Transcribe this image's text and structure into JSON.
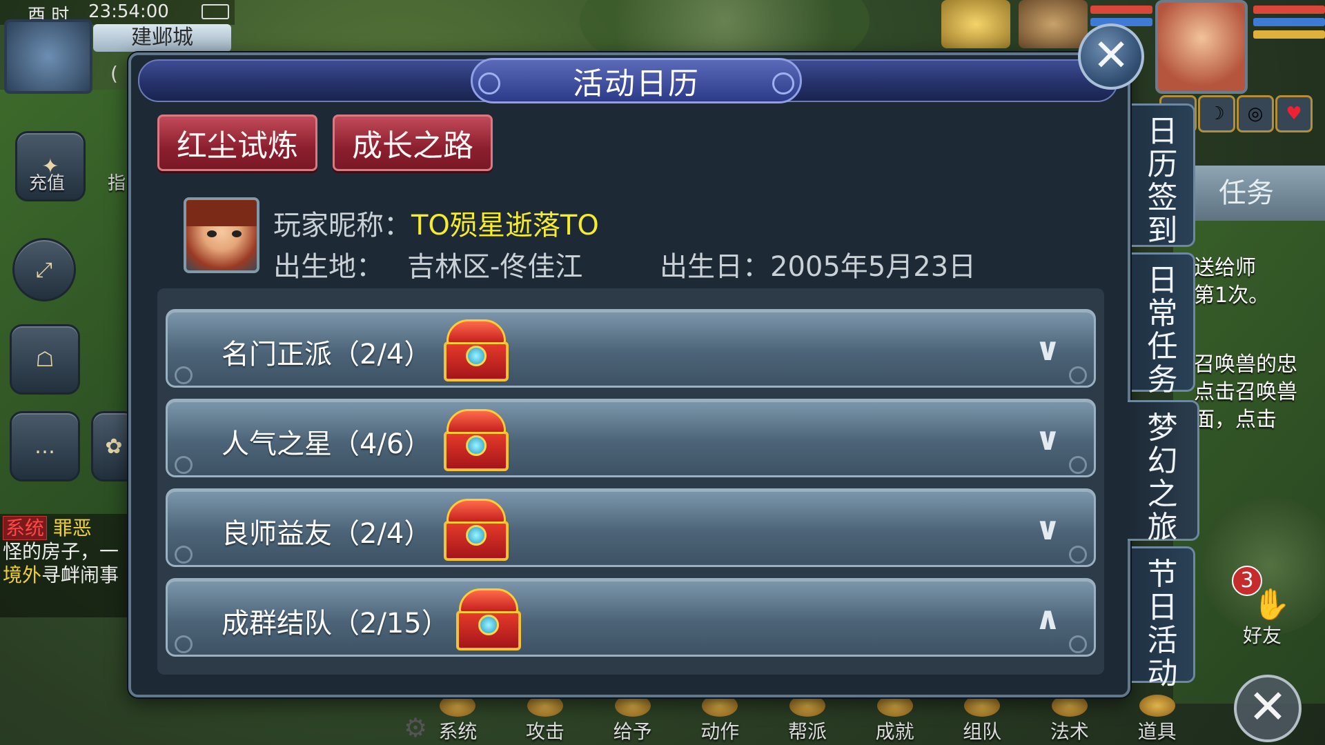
{
  "hud": {
    "clock_label": "酉 时",
    "time": "23:54:00",
    "city": "建邺城",
    "coords_partial": "(",
    "left_buttons": {
      "recharge": "充值",
      "guide": "指"
    }
  },
  "chat": {
    "system_tag": "系统",
    "line1_name": "罪恶",
    "line2": "怪的房子，一",
    "line3_tag": "境外",
    "line3_rest": "寻衅闹事"
  },
  "right_panel": {
    "task_tab": "任务",
    "quest_lines": [
      "送给师",
      "第1次。",
      "召唤兽的忠",
      "点击召唤兽",
      "面，点击"
    ],
    "friend_badge": "3",
    "friend_label": "好友"
  },
  "bottom_menu": [
    "系统",
    "攻击",
    "给予",
    "动作",
    "帮派",
    "成就",
    "组队",
    "法术",
    "道具"
  ],
  "dialog": {
    "title": "活动日历",
    "close": "✕",
    "tabs": [
      "红尘试炼",
      "成长之路"
    ],
    "player": {
      "nickname_label": "玩家昵称：",
      "nickname": "TO殒星逝落TO",
      "birthplace_label": "出生地：",
      "birthplace": "吉林区-佟佳江",
      "birthday_label": "出生日：",
      "birthday": "2005年5月23日"
    },
    "rows": [
      {
        "label": "名门正派（2/4）",
        "chevron": "∨"
      },
      {
        "label": "人气之星（4/6）",
        "chevron": "∨"
      },
      {
        "label": "良师益友（2/4）",
        "chevron": "∨"
      },
      {
        "label": "成群结队（2/15）",
        "chevron": "∧"
      }
    ],
    "side_tabs": [
      "日历签到",
      "日常任务",
      "梦幻之旅",
      "节日活动"
    ]
  },
  "icons": {
    "chest": "treasure-chest-icon",
    "close": "close-icon",
    "settings": "gear-icon"
  }
}
